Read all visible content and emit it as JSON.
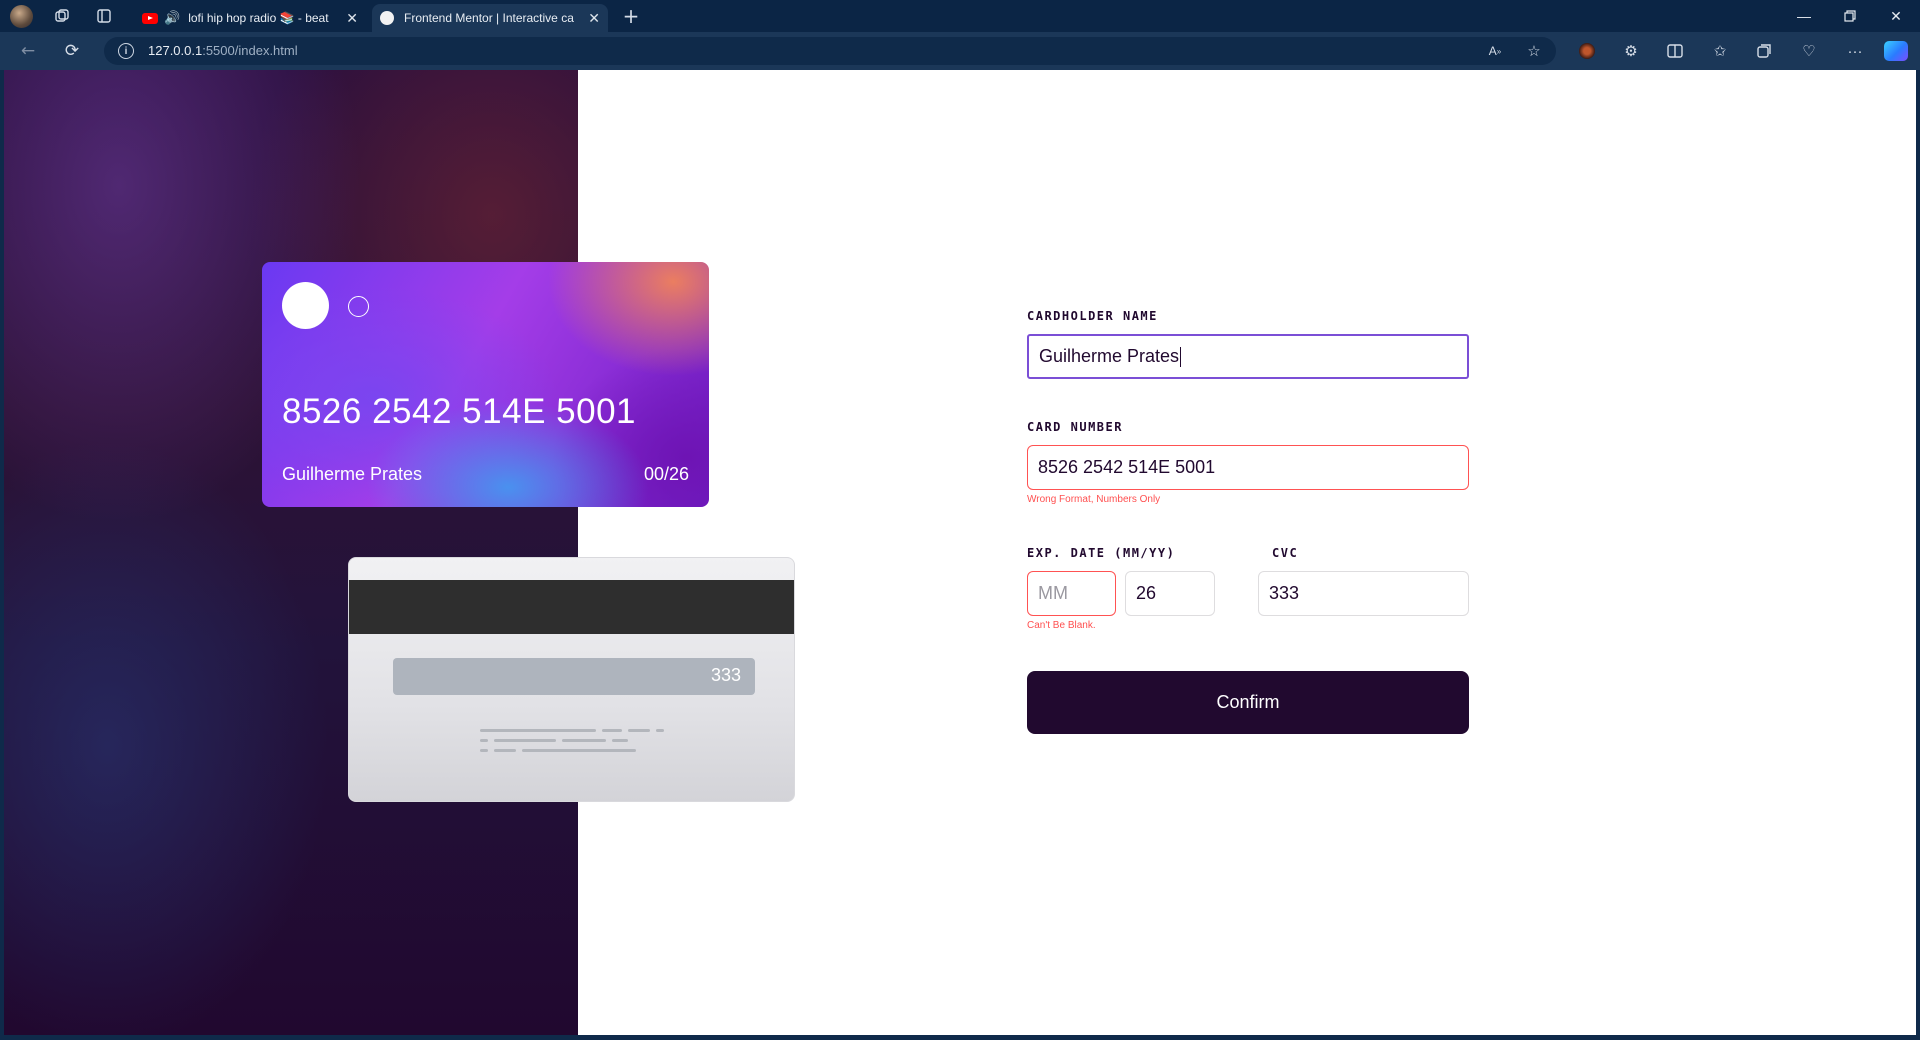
{
  "browser": {
    "tabs": [
      {
        "title": "lofi hip hop radio 📚 - beat",
        "audio": true,
        "favicon": "youtube-icon"
      },
      {
        "title": "Frontend Mentor | Interactive ca",
        "favicon": "frontend-mentor-icon",
        "active": true
      }
    ],
    "url": {
      "host": "127.0.0.1",
      "rest": ":5500/index.html"
    }
  },
  "card_front": {
    "number": "8526 2542 514E 5001",
    "name": "Guilherme Prates",
    "expiry": "00/26"
  },
  "card_back": {
    "cvc": "333"
  },
  "form": {
    "name_label": "CARDHOLDER NAME",
    "name_value": "Guilherme Prates",
    "number_label": "CARD NUMBER",
    "number_value": "8526 2542 514E 5001",
    "number_error": "Wrong Format, Numbers Only",
    "exp_label": "EXP. DATE (MM/YY)",
    "exp_month_placeholder": "MM",
    "exp_year_value": "26",
    "exp_error": "Can't Be Blank.",
    "cvc_label": "CVC",
    "cvc_value": "333",
    "confirm_label": "Confirm"
  },
  "colors": {
    "brand_dark": "#21092f",
    "error": "#ff5252",
    "focus": "#7b4fd6"
  }
}
